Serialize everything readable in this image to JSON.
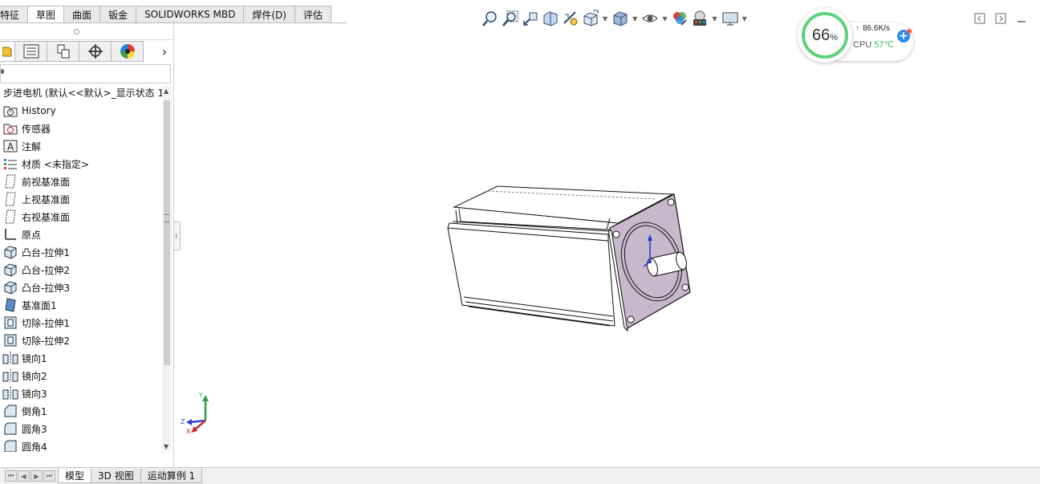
{
  "command_tabs": {
    "tab1": "特征",
    "tab2": "草图",
    "tab3": "曲面",
    "tab4": "钣金",
    "tab5": "SOLIDWORKS MBD",
    "tab6": "焊件(D)",
    "tab7": "评估"
  },
  "feature_tree": {
    "root": "步进电机 (默认<<默认>_显示状态 1",
    "items": {
      "i0": "History",
      "i1": "传感器",
      "i2": "注解",
      "i3": "材质 <未指定>",
      "i4": "前视基准面",
      "i5": "上视基准面",
      "i6": "右视基准面",
      "i7": "原点",
      "i8": "凸台-拉伸1",
      "i9": "凸台-拉伸2",
      "i10": "凸台-拉伸3",
      "i11": "基准面1",
      "i12": "切除-拉伸1",
      "i13": "切除-拉伸2",
      "i14": "镜向1",
      "i15": "镜向2",
      "i16": "镜向3",
      "i17": "倒角1",
      "i18": "圆角3",
      "i19": "圆角4"
    }
  },
  "bottom_tabs": {
    "model": "模型",
    "view3d": "3D 视图",
    "motion": "运动算例 1"
  },
  "widget": {
    "percent": "66",
    "percent_unit": "%",
    "speed": "86.6K/s",
    "cpu_label": "CPU",
    "cpu_temp": "57℃"
  },
  "triad": {
    "y": "Y",
    "z": "Z",
    "x": "X"
  },
  "colors": {
    "face": "#c8b8cc",
    "ring": "#5dd27a",
    "accent_blue": "#2a8be8"
  }
}
